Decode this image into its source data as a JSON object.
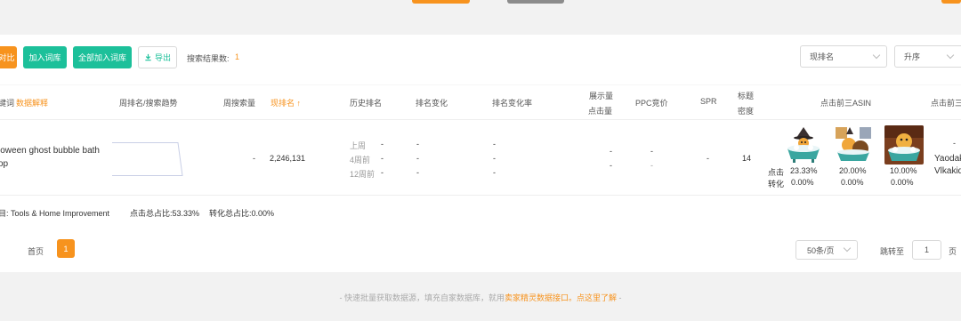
{
  "toolbar": {
    "compare_label": "对比",
    "add_to_lib_label": "加入词库",
    "add_all_to_lib_label": "全部加入词库",
    "export_label": "导出",
    "result_count_label": "搜索结果数:",
    "result_count_value": "1",
    "sort_field_value": "现排名",
    "sort_order_value": "升序"
  },
  "table": {
    "headers": {
      "keyword": "键词",
      "data_explain": "数据解释",
      "week_rank_trend": "周排名/搜索趋势",
      "week_search": "周搜索量",
      "current_rank": "现排名",
      "history_rank": "历史排名",
      "rank_change": "排名变化",
      "rank_change_rate": "排名变化率",
      "impressions": "展示量",
      "clicks": "点击量",
      "ppc": "PPC竞价",
      "spr": "SPR",
      "title_density_1": "标题",
      "title_density_2": "密度",
      "top3_asin": "点击前三ASIN",
      "top3_more": "点击前三"
    },
    "row": {
      "keyword_line1": "loween ghost bubble bath",
      "keyword_line2": "op",
      "week_search": "-",
      "current_rank": "2,246,131",
      "history_labels": [
        "上周",
        "4周前",
        "12周前"
      ],
      "history_values": [
        "-",
        "-",
        "-"
      ],
      "rank_change": [
        "-",
        "-",
        "-"
      ],
      "rank_change_rate": [
        "-",
        "-",
        "-"
      ],
      "impressions": "-",
      "clicks": "-",
      "ppc_top": "-",
      "ppc_bottom": "-",
      "spr": "-",
      "title_density": "14",
      "click_label": "点击",
      "conv_label": "转化",
      "asins": [
        {
          "click": "23.33%",
          "conv": "0.00%"
        },
        {
          "click": "20.00%",
          "conv": "0.00%"
        },
        {
          "click": "10.00%",
          "conv": "0.00%"
        }
      ],
      "brand_dash": "-",
      "brand_line1": "Yaodak",
      "brand_line2": "Vlkakid"
    }
  },
  "summary": {
    "category": "目: Tools & Home Improvement",
    "click_total": "点击总占比:53.33%",
    "conv_total": "转化总占比:0.00%"
  },
  "pagination": {
    "first_label": "首页",
    "current_page": "1",
    "page_size": "50条/页",
    "jump_label": "跳转至",
    "jump_value": "1",
    "page_suffix": "页"
  },
  "footer": {
    "prefix": "- 快速批量获取数据源，填充自家数据库，就用",
    "link": "卖家精灵数据接口。点这里了解",
    "suffix": " -"
  },
  "colors": {
    "orange": "#f7931e",
    "green": "#1cc09a",
    "gray_button": "#8c8c8c"
  }
}
